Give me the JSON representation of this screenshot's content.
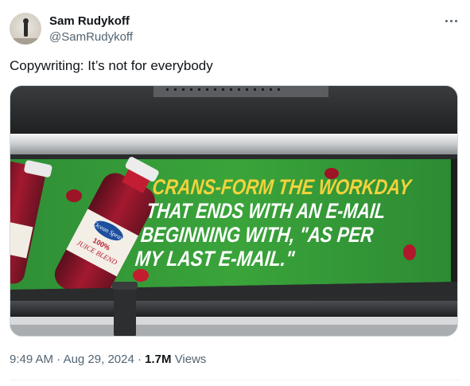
{
  "author": {
    "display_name": "Sam Rudykoff",
    "handle": "@SamRudykoff"
  },
  "tweet": {
    "text": "Copywriting: It’s not for everybody"
  },
  "image": {
    "ad_lines": [
      "CRANS-FORM THE WORKDAY",
      "THAT ENDS WITH AN E-MAIL",
      "BEGINNING WITH, \"AS PER",
      "MY LAST E-MAIL.\""
    ],
    "bottle_brand": "Ocean Spray",
    "bottle_label_line1": "100%",
    "bottle_label_line2": "JUICE BLEND",
    "partial_label": "ND",
    "headline_color": "#f3d23c",
    "body_text_color": "#ffffff",
    "banner_color": "#3aa43a"
  },
  "meta": {
    "time": "9:49 AM",
    "separator": "·",
    "date": "Aug 29, 2024",
    "views_count": "1.7M",
    "views_label": "Views"
  },
  "icons": {
    "more": "more-horizontal-icon"
  }
}
